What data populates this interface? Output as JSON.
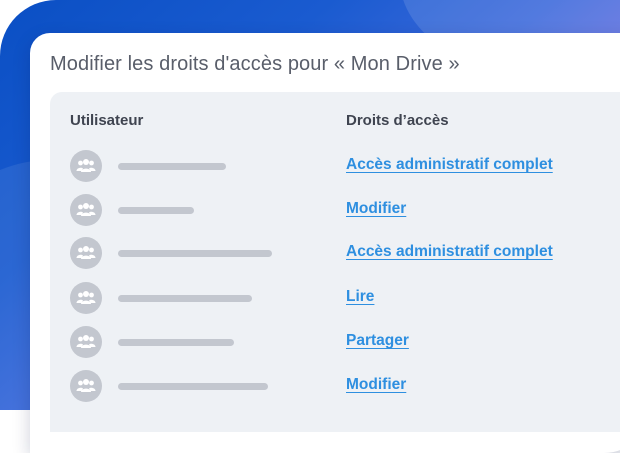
{
  "dialog": {
    "title": "Modifier les droits d'accès pour « Mon Drive »"
  },
  "table": {
    "headers": {
      "user": "Utilisateur",
      "rights": "Droits d’accès"
    },
    "rows": [
      {
        "avatar_icon": "users-group-icon",
        "access": "Accès administratif complet"
      },
      {
        "avatar_icon": "users-group-icon",
        "access": "Modifier"
      },
      {
        "avatar_icon": "users-group-icon",
        "access": "Accès administratif complet"
      },
      {
        "avatar_icon": "users-group-icon",
        "access": "Lire"
      },
      {
        "avatar_icon": "users-group-icon",
        "access": "Partager"
      },
      {
        "avatar_icon": "users-group-icon",
        "access": "Modifier"
      }
    ]
  },
  "colors": {
    "link": "#2e8fe0",
    "panel": "#eef1f5",
    "placeholder": "#c3c7cf"
  }
}
